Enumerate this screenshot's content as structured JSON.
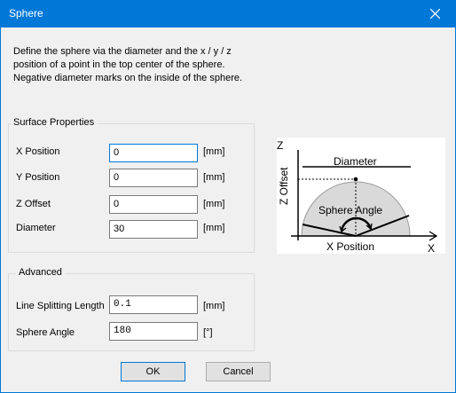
{
  "window": {
    "title": "Sphere"
  },
  "intro": {
    "line1": "Define the sphere via the diameter and the x / y / z",
    "line2": "position of a point in the top center of the sphere.",
    "line3": "Negative diameter marks on the inside of the sphere."
  },
  "surface": {
    "title": "Surface Properties",
    "x_label": "X Position",
    "x_value": "0",
    "x_unit": "[mm]",
    "y_label": "Y Position",
    "y_value": "0",
    "y_unit": "[mm]",
    "z_label": "Z Offset",
    "z_value": "0",
    "z_unit": "[mm]",
    "d_label": "Diameter",
    "d_value": "30",
    "d_unit": "[mm]"
  },
  "advanced": {
    "title": "Advanced",
    "lsl_label": "Line Splitting Length",
    "lsl_value": "0.1",
    "lsl_unit": "[mm]",
    "angle_label": "Sphere Angle",
    "angle_value": "180",
    "angle_unit": "[°]"
  },
  "diagram": {
    "z_axis": "Z",
    "z_offset": "Z Offset",
    "diameter": "Diameter",
    "sphere_angle": "Sphere Angle",
    "x_position": "X Position",
    "x_axis": "X"
  },
  "buttons": {
    "ok": "OK",
    "cancel": "Cancel"
  },
  "colors": {
    "titlebar": "#0078d7",
    "sphere_fill": "#d9d9d9"
  }
}
